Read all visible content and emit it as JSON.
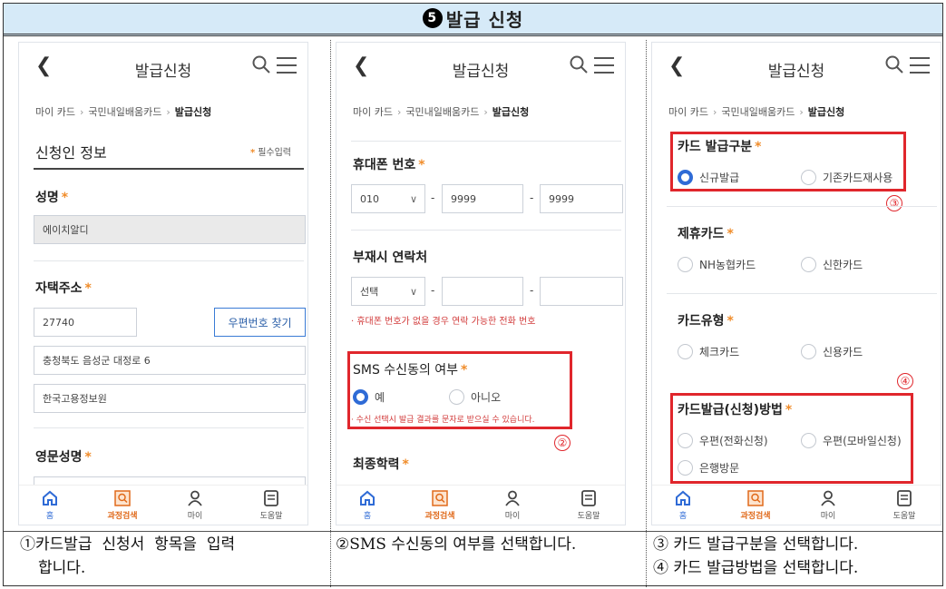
{
  "header": {
    "num": "5",
    "title": "발급 신청"
  },
  "common": {
    "app_title": "발급신청",
    "crumb1": "마이 카드",
    "crumb2": "국민내일배움카드",
    "crumb3": "발급신청",
    "nav": [
      "홈",
      "과정검색",
      "마이",
      "도움말"
    ]
  },
  "panel1": {
    "section": "신청인 정보",
    "required": "필수입력",
    "name_label": "성명",
    "name_value": "에이치알디",
    "address_label": "자택주소",
    "zip": "27740",
    "zip_button": "우편번호 찾기",
    "addr1": "충청북도 음성군 대정로 6",
    "addr2": "한국고용정보원",
    "eng_label": "영문성명"
  },
  "panel2": {
    "phone_label": "휴대폰 번호",
    "phone_prefix": "010",
    "phone_mid": "9999",
    "phone_last": "9999",
    "alt_label": "부재시 연락처",
    "alt_select": "선택",
    "alt_note": "· 휴대폰 번호가 없을 경우 연락 가능한 전화 번호",
    "sms_label": "SMS 수신동의 여부",
    "sms_yes": "예",
    "sms_no": "아니오",
    "sms_note": "· 수신 선택시 발급 결과를 문자로 받으실 수 있습니다.",
    "edu_label": "최종학력",
    "marker": "②"
  },
  "panel3": {
    "issue_type_label": "카드 발급구분",
    "issue_new": "신규발급",
    "issue_reuse": "기존카드재사용",
    "marker3": "③",
    "partner_label": "제휴카드",
    "partner_nh": "NH농협카드",
    "partner_shinhan": "신한카드",
    "type_label": "카드유형",
    "type_check": "체크카드",
    "type_credit": "신용카드",
    "marker4": "④",
    "method_label": "카드발급(신청)방법",
    "method_phone": "우편(전화신청)",
    "method_mobile": "우편(모바일신청)",
    "method_bank": "은행방문"
  },
  "captions": {
    "c1_line1": "①카드발급  신청서  항목을  입력",
    "c1_line2": "합니다.",
    "c2": "②SMS 수신동의 여부를 선택합니다.",
    "c3_line1": "③ 카드 발급구분을 선택합니다.",
    "c3_line2": "④ 카드 발급방법을 선택합니다."
  },
  "colors": {
    "accent": "#2f6bd6",
    "required": "#f08c2a",
    "highlight": "#e0262c",
    "title_bg": "#d6eaf8"
  }
}
